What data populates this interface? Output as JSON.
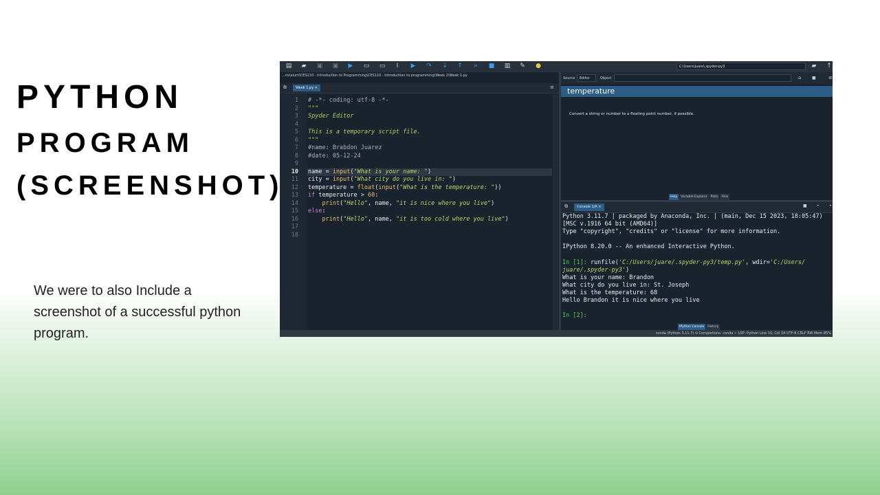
{
  "slide": {
    "title_line1": "PYTHON",
    "title_line2": "PROGRAM",
    "title_line3": "(SCREENSHOT)",
    "description": "We were to also Include a screenshot of a successful python program."
  },
  "ide": {
    "toolbar": {
      "icons": [
        "new-file-icon",
        "open-folder-icon",
        "save-icon",
        "save-all-icon",
        "run-icon",
        "run-cell-icon",
        "run-cell-advance-icon",
        "run-selection-icon",
        "debug-icon",
        "step-icon",
        "step-into-icon",
        "step-out-icon",
        "continue-icon",
        "stop-icon",
        "maximize-pane-icon",
        "preferences-wrench-icon",
        "python-path-icon"
      ],
      "working_dir": "C:\\Users\\juare\\.spyder-py3"
    },
    "editor": {
      "path": "...ris\\alum\\CES110 - Introduction to Programming\\CES110 - Introduction to programming\\Week 2\\Week 1.py",
      "tab_label": "Week 1.py",
      "tab_close": "✕",
      "current_line": 10,
      "lines": [
        {
          "n": "1",
          "text": "# -*- coding: utf-8 -*-"
        },
        {
          "n": "2",
          "text": "\"\"\""
        },
        {
          "n": "3",
          "text": "Spyder Editor"
        },
        {
          "n": "4",
          "text": ""
        },
        {
          "n": "5",
          "text": "This is a temporary script file."
        },
        {
          "n": "6",
          "text": "\"\"\""
        },
        {
          "n": "7",
          "text": "#name: Brabdon Juarez"
        },
        {
          "n": "8",
          "text": "#date: 05-12-24"
        },
        {
          "n": "9",
          "text": ""
        },
        {
          "n": "10",
          "text": "name = input(\"What is your name: \")"
        },
        {
          "n": "11",
          "text": "city = input(\"What city do you live in: \")"
        },
        {
          "n": "12",
          "text": "temperature = float(input(\"What is the temperature: \"))"
        },
        {
          "n": "13",
          "text": "if temperature > 60:"
        },
        {
          "n": "14",
          "text": "    print(\"Hello\", name, \"it is nice where you live\")"
        },
        {
          "n": "15",
          "text": "else:"
        },
        {
          "n": "16",
          "text": "    print(\"Hello\", name, \"it is too cold where you live\")"
        },
        {
          "n": "17",
          "text": ""
        },
        {
          "n": "18",
          "text": ""
        }
      ]
    },
    "help": {
      "source_label": "Source",
      "source_value": "Editor",
      "object_label": "Object",
      "title": "temperature",
      "text": "Convert a string or number to a floating point number, if possible.",
      "tabs": [
        "Help",
        "Variable Explorer",
        "Plots",
        "Files"
      ]
    },
    "console": {
      "tab_label": "Console 1/A",
      "tab_close": "✕",
      "lines": [
        "Python 3.11.7 | packaged by Anaconda, Inc. | (main, Dec 15 2023, 18:05:47)",
        "[MSC v.1916 64 bit (AMD64)]",
        "Type \"copyright\", \"credits\" or \"license\" for more information.",
        "",
        "IPython 8.20.0 -- An enhanced Interactive Python.",
        "",
        "In [1]: runfile('C:/Users/juare/.spyder-py3/temp.py', wdir='C:/Users/",
        "juare/.spyder-py3')",
        "What is your name: Brandon",
        "What city do you live in: St. Joseph",
        "What is the temperature: 68",
        "Hello Brandon it is nice where you live",
        "",
        "In [2]:"
      ],
      "tabs": [
        "IPython Console",
        "History"
      ]
    },
    "status": "conda (Python 3.11.7)   ⟲ Completions: conda   ✓ LSP: Python   Line 10, Col 34   UTF-8   CRLF   RW   Mem 85%"
  }
}
